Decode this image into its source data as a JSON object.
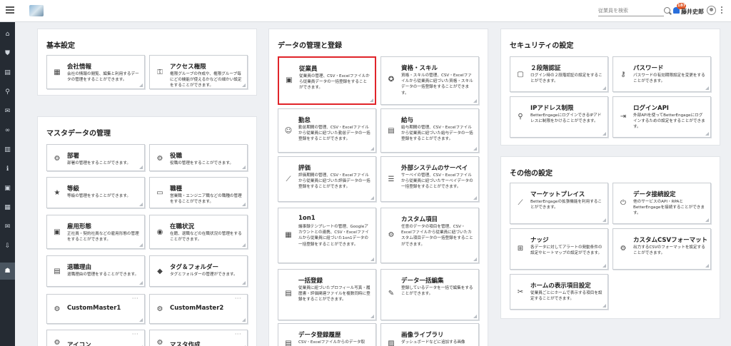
{
  "header": {
    "search_placeholder": "従業員を検索",
    "notification_count": "187",
    "user_name": "藤井史郎"
  },
  "sidebar": {
    "items": [
      {
        "icon": "home-icon",
        "glyph": "⌂"
      },
      {
        "icon": "org-chart-icon",
        "glyph": "⛊"
      },
      {
        "icon": "document-icon",
        "glyph": "▤"
      },
      {
        "icon": "search-icon",
        "glyph": "⚲"
      },
      {
        "icon": "chat-icon",
        "glyph": "✉"
      },
      {
        "icon": "link-icon",
        "glyph": "∞"
      },
      {
        "icon": "chart-icon",
        "glyph": "▥"
      },
      {
        "icon": "info-icon",
        "glyph": "ℹ"
      },
      {
        "icon": "id-card-icon",
        "glyph": "▣"
      },
      {
        "icon": "book-icon",
        "glyph": "▦"
      },
      {
        "icon": "mail-icon",
        "glyph": "✉"
      },
      {
        "icon": "download-icon",
        "glyph": "⇩"
      },
      {
        "icon": "users-settings-icon",
        "glyph": "☗"
      }
    ]
  },
  "sections": {
    "basic": {
      "title": "基本設定",
      "cards": [
        {
          "name": "会社情報",
          "desc": "会社の情報の閲覧、編集と利用するデータの管理をすることができます。"
        },
        {
          "name": "アクセス権限",
          "desc": "権限グループの作成や、権限グループ毎にどの機能が使えるかなどの細かい設定をすることができます。"
        }
      ]
    },
    "master": {
      "title": "マスタデータの管理",
      "cards": [
        {
          "name": "部署",
          "desc": "部署の管理をすることができます。"
        },
        {
          "name": "役職",
          "desc": "役職の管理をすることができます。"
        },
        {
          "name": "等級",
          "desc": "等級の管理をすることができます。"
        },
        {
          "name": "職種",
          "desc": "営業職・エンジニア職などの職種の管理をすることができます。"
        },
        {
          "name": "雇用形態",
          "desc": "正社員・契約社員などの雇用形態の管理をすることができます。"
        },
        {
          "name": "在職状況",
          "desc": "在籍、退職などの在職状況の管理をすることができます。"
        },
        {
          "name": "退職理由",
          "desc": "退職理由の管理をすることができます。"
        },
        {
          "name": "タグ＆フォルダー",
          "desc": "タグとフォルダーの管理ができます。"
        },
        {
          "name": "CustomMaster1",
          "desc": ""
        },
        {
          "name": "CustomMaster2",
          "desc": ""
        },
        {
          "name": "アイコン",
          "desc": ""
        },
        {
          "name": "マスタ作成",
          "desc": ""
        }
      ]
    },
    "data": {
      "title": "データの管理と登録",
      "cards": [
        {
          "name": "従業員",
          "desc": "従業員の管理、CSV・Excelファイルから従業員データの一括登録をすることができます。"
        },
        {
          "name": "資格・スキル",
          "desc": "資格・スキルの管理、CSV・Excelファイルから従業員に紐づいた資格・スキルデータの一括登録をすることができます。"
        },
        {
          "name": "勤怠",
          "desc": "勤怠期間の管理、CSV・Excelファイルから従業員に紐づいた勤怠データの一括登録をすることができます。"
        },
        {
          "name": "給与",
          "desc": "給与期間の管理、CSV・Excelファイルから従業員に紐づいた給与データの一括登録をすることができます。"
        },
        {
          "name": "評価",
          "desc": "評価期間の管理、CSV・Excelファイルから従業員に紐づいた評価データの一括登録をすることができます。"
        },
        {
          "name": "外部システムのサーベイ",
          "desc": "サーベイの管理、CSV・Excelファイルから従業員に紐づいたサーベイデータの一括登録をすることができます。"
        },
        {
          "name": "1on1",
          "desc": "議事録テンプレートの管理、Googleアカウントとの連携、CSV・Excelファイルから従業員に紐づいた1on1データの一括登録をすることができます。"
        },
        {
          "name": "カスタム項目",
          "desc": "任意のデータの項目を管理、CSV・Excelファイルから従業員に紐づいたカスタム項目データの一括登録をすることができます。"
        },
        {
          "name": "一括登録",
          "desc": "従業員に紐づいたプロフィール写真・履歴書・評価関連ファイルを複数同時に登録をすることができます。"
        },
        {
          "name": "データ一括編集",
          "desc": "登録しているデータを一括で編集をすることができます。"
        },
        {
          "name": "データ登録履歴",
          "desc": "CSV・Excelファイルからのデータ取"
        },
        {
          "name": "画像ライブラリ",
          "desc": "ダッシュボードなどに追加する画像"
        }
      ]
    },
    "security": {
      "title": "セキュリティの設定",
      "cards": [
        {
          "name": "２段階認証",
          "desc": "ログイン時の２段階認証の設定をすることができます。"
        },
        {
          "name": "パスワード",
          "desc": "パスワードの有効期限設定を変更をすることができます。"
        },
        {
          "name": "IPアドレス制限",
          "desc": "BetterEngageにログインできるIPアドレスに制限をかけることができます。"
        },
        {
          "name": "ログインAPI",
          "desc": "外部APIを使ってBetterEngageにログインするための設定をすることができます。"
        }
      ]
    },
    "other": {
      "title": "その他の設定",
      "cards": [
        {
          "name": "マーケットプレイス",
          "desc": "BetterEngageの拡張機能を利用することができます。"
        },
        {
          "name": "データ接続設定",
          "desc": "他のサービスのAPI・RPAとBetterEngageを接続することができます。"
        },
        {
          "name": "ナッジ",
          "desc": "各データに対してアラートの発動条件の設定やヒートマップの設定ができます。"
        },
        {
          "name": "カスタムCSVフォーマット",
          "desc": "出力するCSVのフォーマットを設定することができます。"
        },
        {
          "name": "ホームの表示項目設定",
          "desc": "従業員ごとにホームで表示する項目を設定することができます。"
        }
      ]
    }
  },
  "colors": {
    "sidebar_bg": "#252b33",
    "highlight": "#e0242a",
    "accent": "#2a6fdb",
    "badge": "#e05a2b"
  }
}
